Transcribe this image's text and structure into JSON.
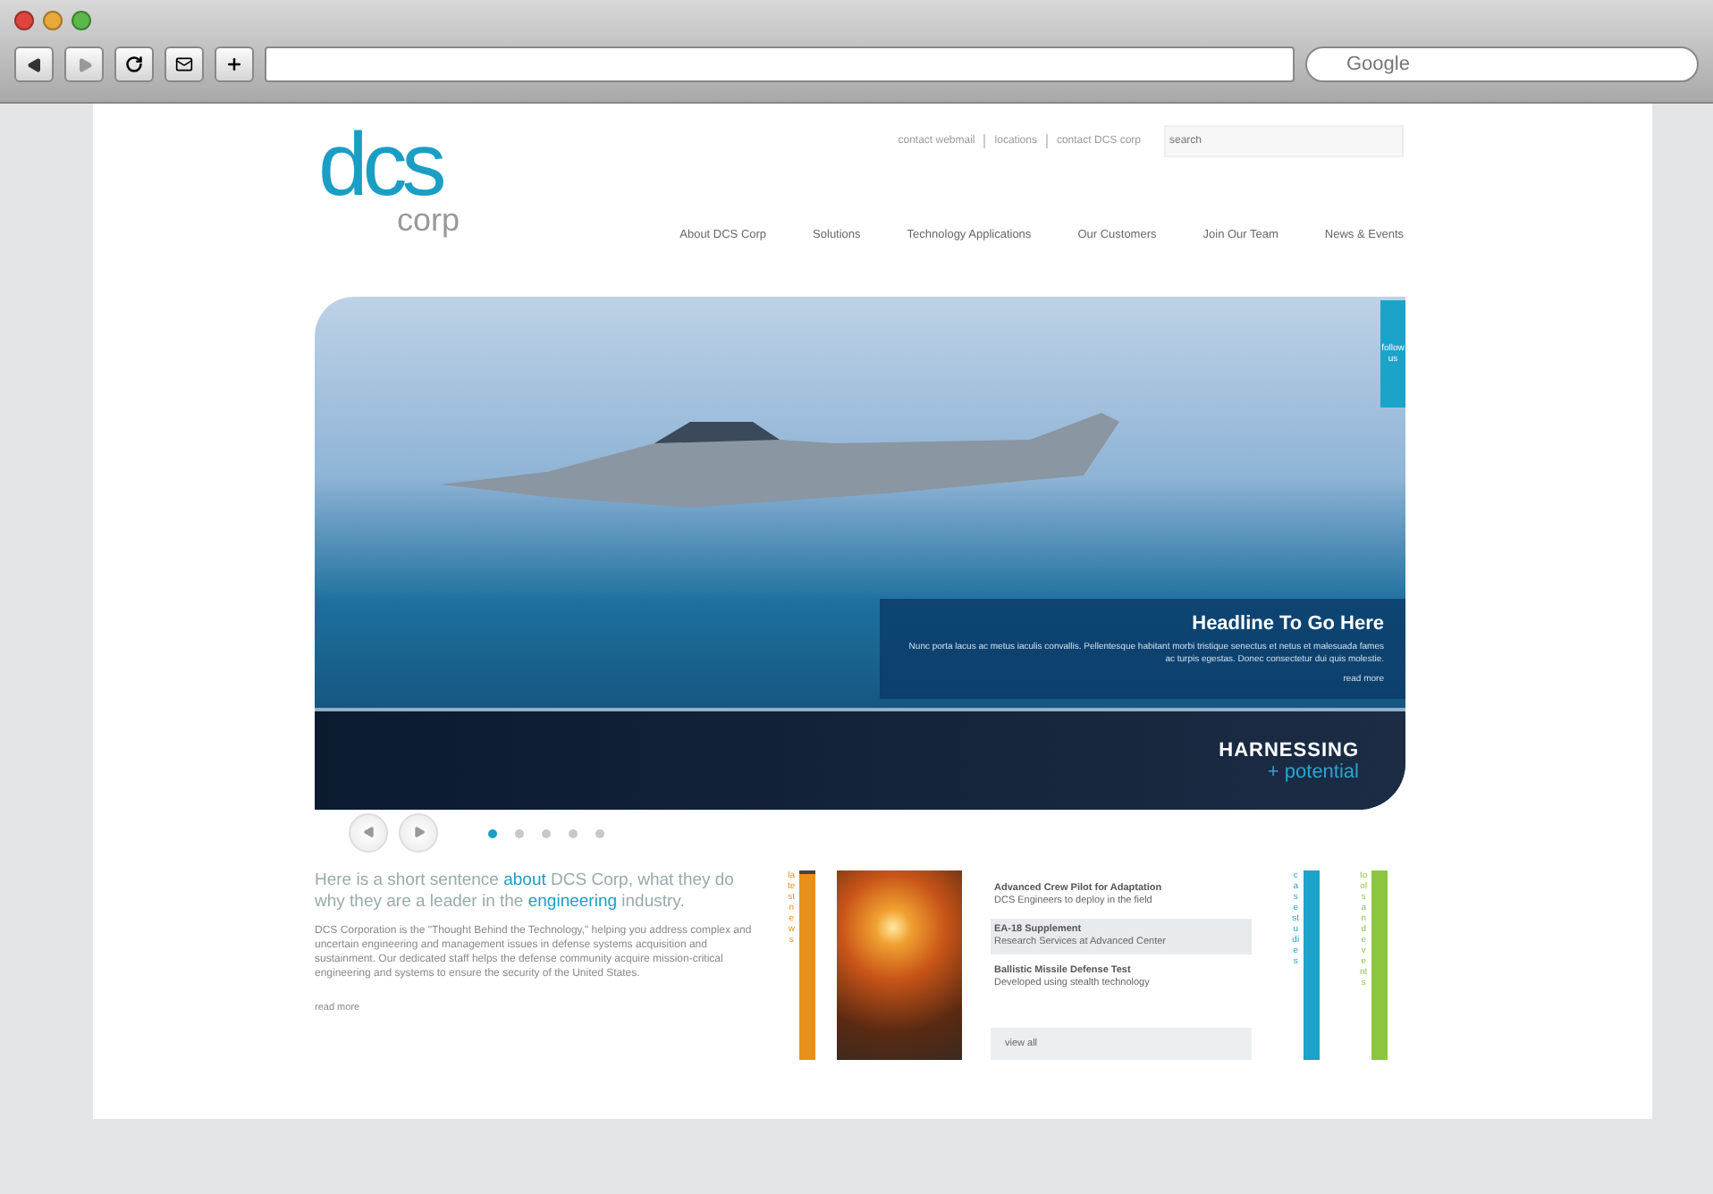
{
  "browser": {
    "search_placeholder": "Google"
  },
  "site": {
    "logo": {
      "mark": "dcs",
      "sub": "corp"
    },
    "utility_links": [
      "contact webmail",
      "locations",
      "contact DCS corp"
    ],
    "search_placeholder": "search",
    "nav": [
      "About DCS Corp",
      "Solutions",
      "Technology Applications",
      "Our Customers",
      "Join Our Team",
      "News & Events"
    ],
    "hero": {
      "side_tab": "follow us",
      "headline": "Headline To Go Here",
      "body": "Nunc porta lacus ac metus iaculis convallis. Pellentesque habitant morbi tristique senectus et netus et malesuada fames ac turpis egestas. Donec consectetur dui quis molestie.",
      "link": "read more",
      "tagline_top": "HARNESSING",
      "tagline_bottom": "+ potential"
    },
    "slides": [
      {
        "selected": true
      },
      {
        "selected": false
      },
      {
        "selected": false
      },
      {
        "selected": false
      },
      {
        "selected": false
      }
    ],
    "intro": {
      "lead": "Here is a short sentence **about** DCS Corp, what they do why they are a leader in the **engineering** industry.",
      "body": "DCS Corporation is the \"Thought Behind the Technology,\" helping you address complex and uncertain engineering and management issues in defense systems acquisition and sustainment. Our dedicated staff helps the defense community acquire mission-critical engineering and systems to ensure the security of the United States.",
      "link": "read more"
    },
    "tabs": [
      {
        "label": "latest news",
        "color": "#e8901a",
        "selected": true
      },
      {
        "label": "case studies",
        "color": "#1ba3c9",
        "selected": false
      },
      {
        "label": "tools and events",
        "color": "#8cc63f",
        "selected": false
      }
    ],
    "news": [
      {
        "title": "Advanced Crew Pilot for Adaptation",
        "text": "DCS Engineers to deploy in the field",
        "selected": false
      },
      {
        "title": "EA-18 Supplement",
        "text": "Research Services at Advanced Center",
        "selected": true
      },
      {
        "title": "Ballistic Missile Defense Test",
        "text": "Developed using stealth technology",
        "selected": false
      }
    ],
    "news_link": "view all"
  }
}
